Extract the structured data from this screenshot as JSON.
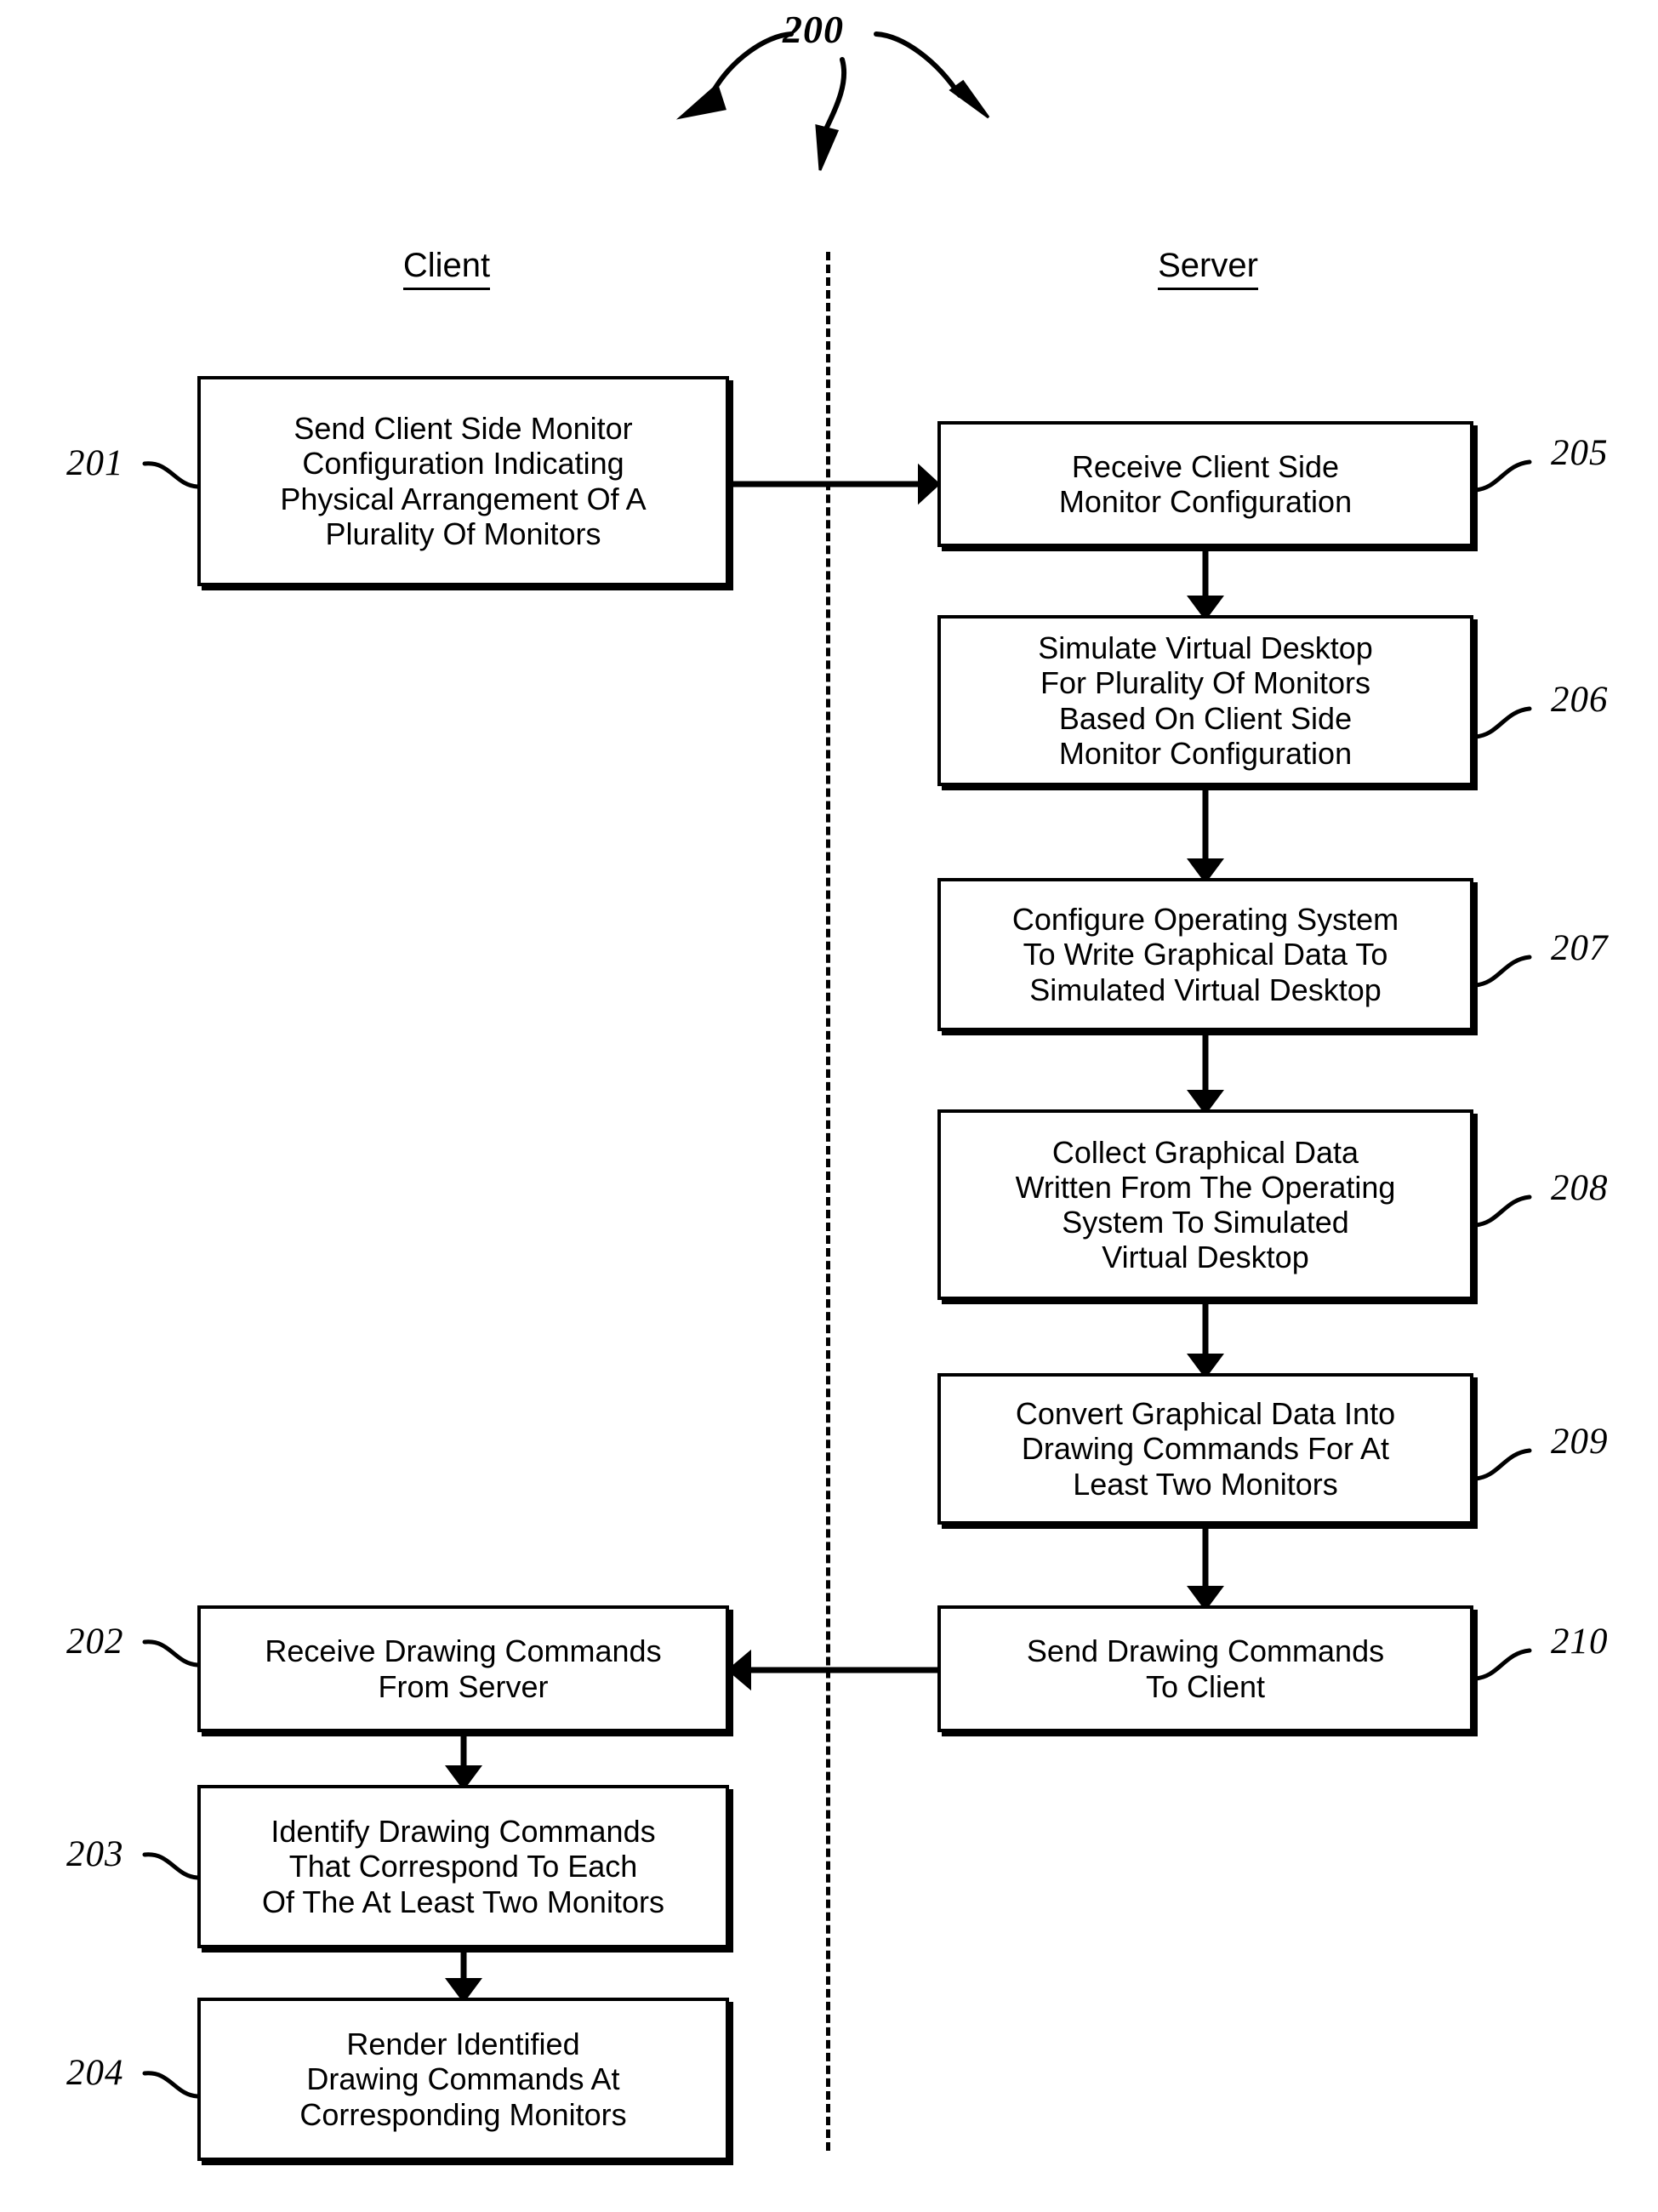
{
  "figure": {
    "number": "200",
    "callout_arrows": 3
  },
  "columns": {
    "client_label": "Client",
    "server_label": "Server"
  },
  "nodes": [
    {
      "ref": "201",
      "column": "client",
      "text": "Send Client Side Monitor\nConfiguration Indicating\nPhysical Arrangement Of A\nPlurality Of Monitors"
    },
    {
      "ref": "202",
      "column": "client",
      "text": "Receive Drawing Commands\nFrom Server"
    },
    {
      "ref": "203",
      "column": "client",
      "text": "Identify Drawing Commands\nThat Correspond To Each\nOf The At Least Two Monitors"
    },
    {
      "ref": "204",
      "column": "client",
      "text": "Render Identified\nDrawing Commands  At\nCorresponding Monitors"
    },
    {
      "ref": "205",
      "column": "server",
      "text": "Receive Client Side\nMonitor Configuration"
    },
    {
      "ref": "206",
      "column": "server",
      "text": "Simulate Virtual Desktop\nFor Plurality Of Monitors\nBased On Client Side\nMonitor Configuration"
    },
    {
      "ref": "207",
      "column": "server",
      "text": "Configure Operating System\nTo Write Graphical Data To\nSimulated Virtual Desktop"
    },
    {
      "ref": "208",
      "column": "server",
      "text": "Collect Graphical Data\nWritten From The Operating\nSystem To Simulated\nVirtual Desktop"
    },
    {
      "ref": "209",
      "column": "server",
      "text": "Convert Graphical Data Into\nDrawing Commands For At\nLeast Two Monitors"
    },
    {
      "ref": "210",
      "column": "server",
      "text": "Send Drawing Commands\nTo Client"
    }
  ],
  "connectors": [
    {
      "from": "201",
      "to": "205",
      "direction": "right",
      "crosses_divider": true
    },
    {
      "from": "205",
      "to": "206",
      "direction": "down",
      "crosses_divider": false
    },
    {
      "from": "206",
      "to": "207",
      "direction": "down",
      "crosses_divider": false
    },
    {
      "from": "207",
      "to": "208",
      "direction": "down",
      "crosses_divider": false
    },
    {
      "from": "208",
      "to": "209",
      "direction": "down",
      "crosses_divider": false
    },
    {
      "from": "209",
      "to": "210",
      "direction": "down",
      "crosses_divider": false
    },
    {
      "from": "210",
      "to": "202",
      "direction": "left",
      "crosses_divider": true
    },
    {
      "from": "202",
      "to": "203",
      "direction": "down",
      "crosses_divider": false
    },
    {
      "from": "203",
      "to": "204",
      "direction": "down",
      "crosses_divider": false
    }
  ],
  "style": {
    "ink": "#000000",
    "paper": "#ffffff"
  }
}
